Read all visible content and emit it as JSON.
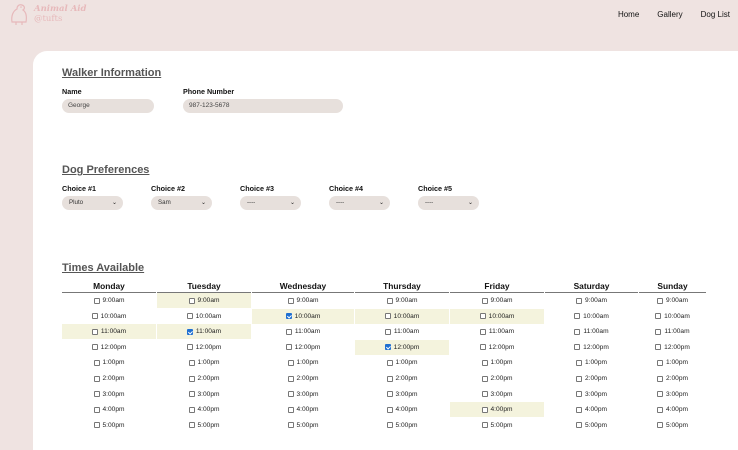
{
  "header": {
    "logo_line1": "Animal Aid",
    "logo_line2": "@tufts",
    "nav": [
      "Home",
      "Gallery",
      "Dog List"
    ]
  },
  "walker": {
    "title": "Walker Information",
    "name_label": "Name",
    "name_value": "George",
    "phone_label": "Phone Number",
    "phone_value": "987-123-5678"
  },
  "prefs": {
    "title": "Dog Preferences",
    "choices": [
      {
        "label": "Choice #1",
        "value": "Pluto"
      },
      {
        "label": "Choice #2",
        "value": "Sam"
      },
      {
        "label": "Choice #3",
        "value": "----"
      },
      {
        "label": "Choice #4",
        "value": "----"
      },
      {
        "label": "Choice #5",
        "value": "----"
      }
    ]
  },
  "times": {
    "title": "Times Available",
    "days": [
      "Monday",
      "Tuesday",
      "Wednesday",
      "Thursday",
      "Friday",
      "Saturday",
      "Sunday"
    ],
    "slots": [
      "9:00am",
      "10:00am",
      "11:00am",
      "12:00pm",
      "1:00pm",
      "2:00pm",
      "3:00pm",
      "4:00pm",
      "5:00pm"
    ],
    "checked": [
      {
        "day": 1,
        "slot": 2
      },
      {
        "day": 2,
        "slot": 1
      },
      {
        "day": 3,
        "slot": 3
      }
    ],
    "highlighted": [
      {
        "day": 0,
        "slot": 2
      },
      {
        "day": 1,
        "slot": 0
      },
      {
        "day": 1,
        "slot": 2
      },
      {
        "day": 2,
        "slot": 1
      },
      {
        "day": 3,
        "slot": 1
      },
      {
        "day": 3,
        "slot": 3
      },
      {
        "day": 4,
        "slot": 1
      },
      {
        "day": 4,
        "slot": 7
      }
    ]
  }
}
